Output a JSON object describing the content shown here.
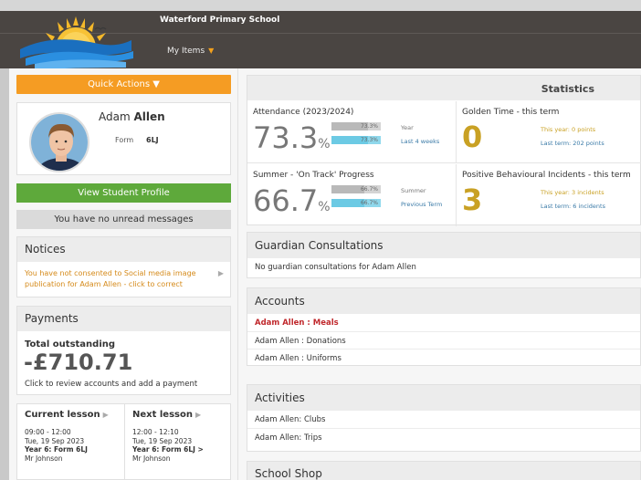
{
  "header": {
    "school_name": "Waterford Primary School",
    "my_items": "My Items"
  },
  "left": {
    "quick_actions": "Quick Actions",
    "student": {
      "first_name": "Adam",
      "last_name": "Allen",
      "form_label": "Form",
      "form_value": "6LJ"
    },
    "view_profile": "View Student Profile",
    "messages": "You have no unread messages",
    "notices": {
      "title": "Notices",
      "item": "You have not consented to Social media image publication for Adam Allen - click to correct"
    },
    "payments": {
      "title": "Payments",
      "total_label": "Total outstanding",
      "amount": "-£710.71",
      "hint": "Click to review accounts and add a payment"
    },
    "current_lesson": {
      "title": "Current lesson",
      "time": "09:00 - 12:00",
      "date": "Tue, 19 Sep 2023",
      "class": "Year 6: Form 6LJ",
      "teacher": "Mr Johnson"
    },
    "next_lesson": {
      "title": "Next lesson",
      "time": "12:00 - 12:10",
      "date": "Tue, 19 Sep 2023",
      "class": "Year 6: Form 6LJ >",
      "teacher": "Mr Johnson"
    }
  },
  "stats": {
    "title": "Statistics",
    "attendance": {
      "label": "Attendance (2023/2024)",
      "value": "73.3",
      "unit": "%",
      "bar1": "73.3%",
      "bar1_label": "Year",
      "bar1_fill": 0.733,
      "bar2": "73.3%",
      "bar2_label": "Last 4 weeks",
      "bar2_fill": 0.733
    },
    "progress": {
      "label": "Summer - 'On Track' Progress",
      "value": "66.7",
      "unit": "%",
      "bar1": "66.7%",
      "bar1_label": "Summer",
      "bar1_fill": 0.667,
      "bar2": "66.7%",
      "bar2_label": "Previous Term",
      "bar2_fill": 0.667
    },
    "golden": {
      "label": "Golden Time - this term",
      "value": "0",
      "line1": "This year: 0 points",
      "line2": "Last term: 202 points"
    },
    "behaviour": {
      "label": "Positive Behavioural Incidents - this term",
      "value": "3",
      "line1": "This year: 3 incidents",
      "line2": "Last term: 6 incidents"
    }
  },
  "guardian": {
    "title": "Guardian Consultations",
    "text": "No guardian consultations for Adam Allen"
  },
  "accounts": {
    "title": "Accounts",
    "items": [
      "Adam Allen : Meals",
      "Adam Allen : Donations",
      "Adam Allen : Uniforms"
    ]
  },
  "activities": {
    "title": "Activities",
    "items": [
      "Adam Allen: Clubs",
      "Adam Allen: Trips"
    ]
  },
  "shop": {
    "title": "School Shop"
  },
  "colors": {
    "header_bg": "#4a4542",
    "orange": "#f59c23",
    "green": "#5ea93b",
    "gold": "#c9a124",
    "link_blue": "#3a7aa7",
    "alert_red": "#c0282c",
    "bar_blue": "#8fd8ec"
  }
}
